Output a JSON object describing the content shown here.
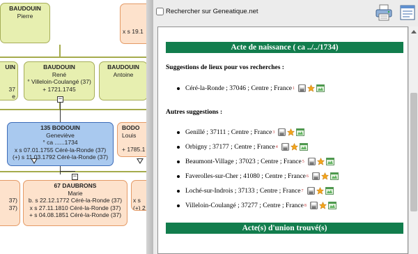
{
  "tree": {
    "nodes": {
      "pierre": {
        "name": "BAUDOUIN",
        "first": "Pierre"
      },
      "top_right": {
        "line1": "x s 19.1"
      },
      "mid_left": {
        "name": "UIN",
        "l1": "37",
        "l2": "e"
      },
      "rene": {
        "name": "BAUDOUIN",
        "first": "René",
        "l1": "° Villeloin-Coulangé (37)",
        "l2": "+ 1721.1745"
      },
      "antoine": {
        "name": "BAUDOUIN",
        "first": "Antoine"
      },
      "genevieve": {
        "name": "135 BODOUIN",
        "first": "Geneviève",
        "l1": "° ca ......1734",
        "l2": "x s 07.01.1755 Céré-la-Ronde (37)",
        "l3": "(+) s 11.03.1792 Céré-la-Ronde (37)"
      },
      "louis": {
        "name": "BODO",
        "first": "Louis",
        "l1": "+ 1785.1"
      },
      "bottom_left": {
        "l1": "37)",
        "l2": "37)"
      },
      "marie": {
        "name": "67 DAUBRONS",
        "first": "Marie",
        "l1": "b. s 22.12.1772 Céré-la-Ronde (37)",
        "l2": "x s 27.11.1810 Céré-la-Ronde (37)",
        "l3": "+ s 04.08.1851 Céré-la-Ronde (37)"
      },
      "bottom_right": {
        "l1": "x s",
        "l2": "(+) 2"
      }
    },
    "collapse_symbol": "−"
  },
  "panel": {
    "search_checkbox_label": "Rechercher sur Geneatique.net",
    "search_checked": false,
    "toolbar_icons": [
      "printer-icon",
      "document-icon"
    ],
    "birth_banner": "Acte de naissance ( ca ../../1734)",
    "suggestions_heading": "Suggestions de lieux pour vos recherches :",
    "main_suggestion": {
      "text": "Céré-la-Ronde ; 37046 ; Centre ; France",
      "ref": "1"
    },
    "other_heading": "Autres suggestions :",
    "other_suggestions": [
      {
        "text": "Genillé ; 37111 ; Centre ; France",
        "ref": "3"
      },
      {
        "text": "Orbigny ; 37177 ; Centre ; France",
        "ref": "4"
      },
      {
        "text": "Beaumont-Village ; 37023 ; Centre ; France",
        "ref": "5"
      },
      {
        "text": "Faverolles-sur-Cher ; 41080 ; Centre ; France",
        "ref": "6"
      },
      {
        "text": "Loché-sur-Indrois ; 37133 ; Centre ; France",
        "ref": "7"
      },
      {
        "text": "Villeloin-Coulangé ; 37277 ; Centre ; France",
        "ref": "8"
      }
    ],
    "union_banner": "Acte(s) d'union trouvé(s)"
  },
  "colors": {
    "banner": "#127d4d",
    "green_node": "#e7efb0",
    "blue_node": "#a9c9ef",
    "orange_node": "#fde2cc"
  }
}
